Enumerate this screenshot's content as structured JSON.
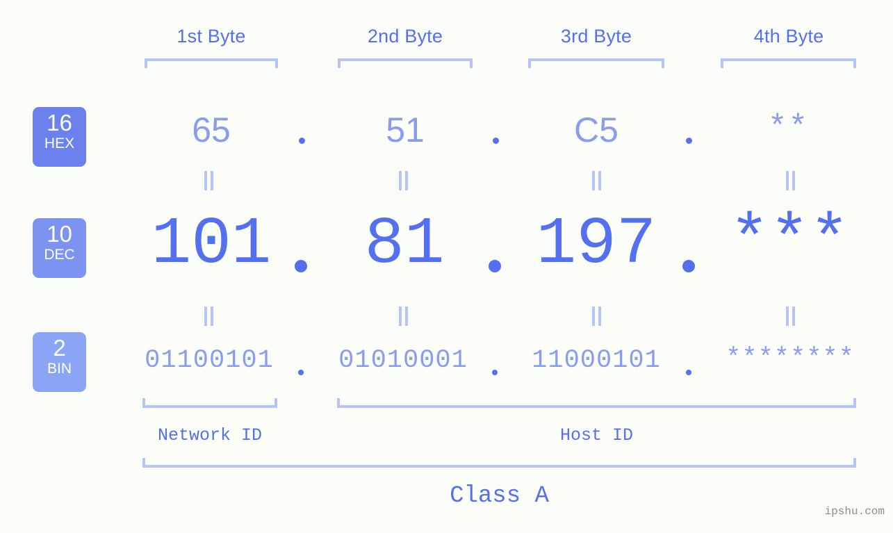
{
  "page": {
    "background": "#fbfdf9",
    "accent": "#5470ee",
    "accent_light": "#8a9cf0",
    "bracket_color": "#b6c3f7",
    "watermark": "ipshu.com"
  },
  "columns": [
    {
      "header": "1st Byte"
    },
    {
      "header": "2nd Byte"
    },
    {
      "header": "3rd Byte"
    },
    {
      "header": "4th Byte"
    }
  ],
  "rows": [
    {
      "badge_number": "16",
      "badge_name": "HEX",
      "badge_color": "#6b82ee",
      "values": [
        "65",
        "51",
        "C5",
        "**"
      ],
      "separator": "."
    },
    {
      "badge_number": "10",
      "badge_name": "DEC",
      "badge_color": "#7d93f2",
      "values": [
        "101",
        "81",
        "197",
        "***"
      ],
      "separator": "."
    },
    {
      "badge_number": "2",
      "badge_name": "BIN",
      "badge_color": "#8aa5f5",
      "values": [
        "01100101",
        "01010001",
        "11000101",
        "********"
      ],
      "separator": "."
    }
  ],
  "equals_marker": "=",
  "sections": {
    "network_id": "Network ID",
    "host_id": "Host ID",
    "class": "Class A"
  }
}
